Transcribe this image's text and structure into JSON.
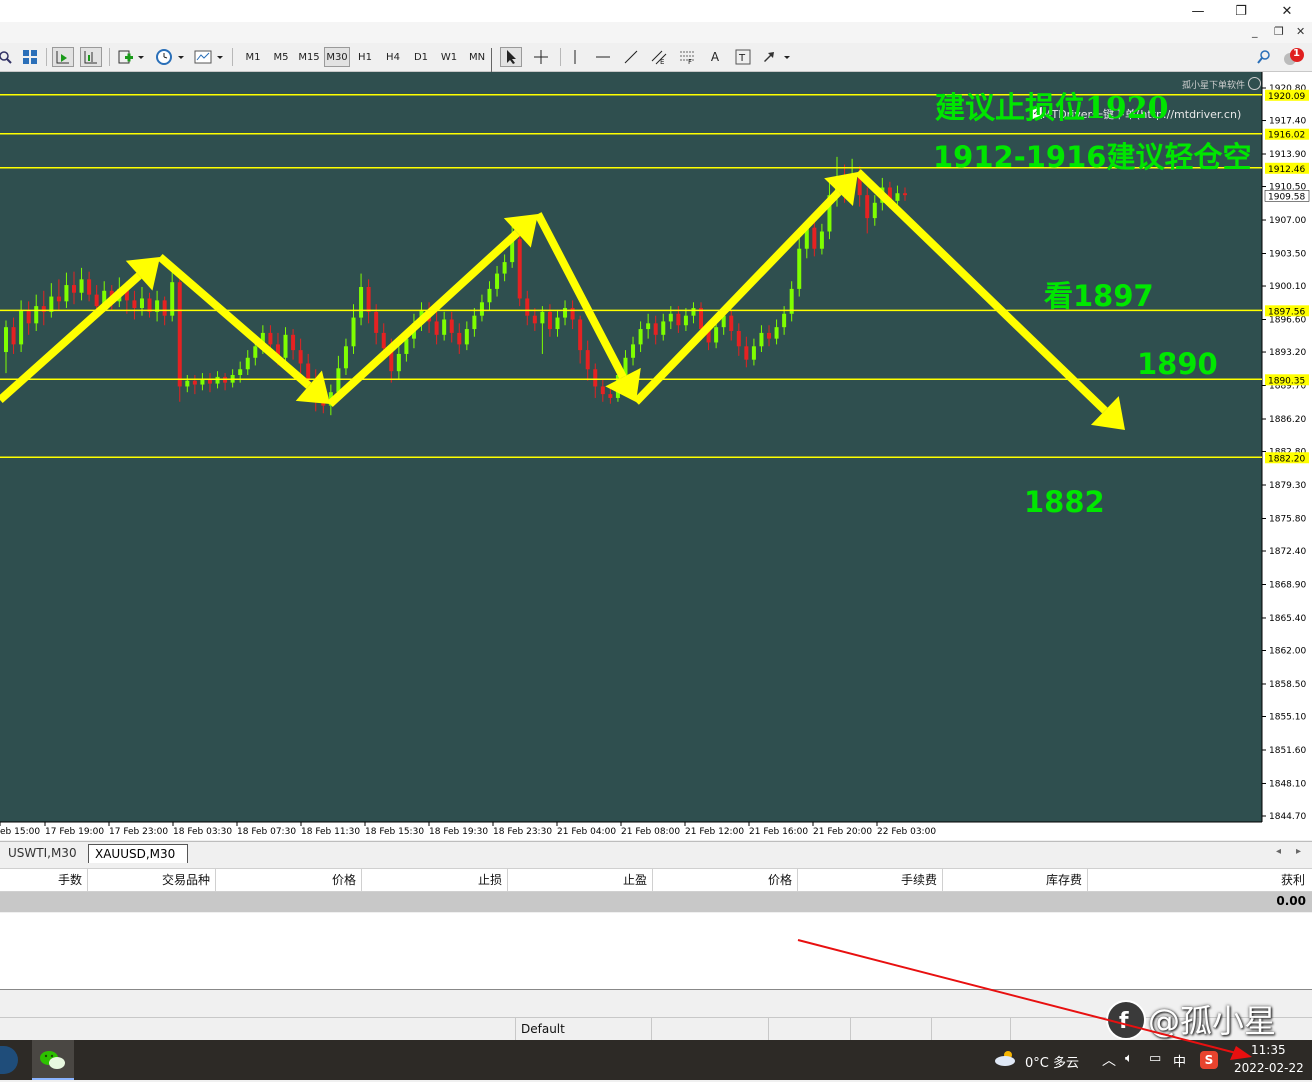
{
  "window": {
    "minimize_glyph": "—",
    "restore_glyph": "❐",
    "close_glyph": "✕"
  },
  "toolbar": {
    "timeframes": [
      "M1",
      "M5",
      "M15",
      "M30",
      "H1",
      "H4",
      "D1",
      "W1",
      "MN"
    ],
    "active_timeframe": "M30",
    "text_tool": "A",
    "notification_count": "1"
  },
  "chart": {
    "symbol": "XAUUSD,M30",
    "watermark": "孤小星下单软件",
    "ea_label": "MTDriver一键下单(http://mtdriver.cn)",
    "colors": {
      "background": "#2f4f4f",
      "bull": "#7fff00",
      "bear": "#e52222",
      "level_line": "#ffff00",
      "arrow": "#ffff00",
      "annotation": "#00e600"
    },
    "annotations": [
      "建议止损位1920",
      "1912-1916建议轻仓空",
      "看1897",
      "1890",
      "1882"
    ],
    "level_tags": [
      "1920.09",
      "1916.02",
      "1912.46",
      "1909.58",
      "1897.56",
      "1890.35",
      "1882.20"
    ],
    "price_axis": [
      "1920.80",
      "1917.40",
      "1913.90",
      "1910.50",
      "1907.00",
      "1903.50",
      "1900.10",
      "1896.60",
      "1893.20",
      "1889.70",
      "1886.20",
      "1882.80",
      "1879.30",
      "1875.80",
      "1872.40",
      "1868.90",
      "1865.40",
      "1862.00",
      "1858.50",
      "1855.10",
      "1851.60",
      "1848.10",
      "1844.70"
    ],
    "time_axis": [
      "eb 15:00",
      "17 Feb 19:00",
      "17 Feb 23:00",
      "18 Feb 03:30",
      "18 Feb 07:30",
      "18 Feb 11:30",
      "18 Feb 15:30",
      "18 Feb 19:30",
      "18 Feb 23:30",
      "21 Feb 04:00",
      "21 Feb 08:00",
      "21 Feb 12:00",
      "21 Feb 16:00",
      "21 Feb 20:00",
      "22 Feb 03:00"
    ]
  },
  "chart_tabs": [
    "USWTI,M30",
    "XAUUSD,M30"
  ],
  "active_tab": "XAUUSD,M30",
  "terminal": {
    "columns": [
      "手数",
      "交易品种",
      "价格",
      "止损",
      "止盈",
      "价格",
      "手续费",
      "库存费",
      "获利"
    ],
    "total_profit": "0.00"
  },
  "statusbar": {
    "profile": "Default"
  },
  "taskbar": {
    "weather": "0°C 多云",
    "ime": "中",
    "time": "11:35",
    "date": "2022-02-22",
    "watermark": "@孤小星"
  }
}
